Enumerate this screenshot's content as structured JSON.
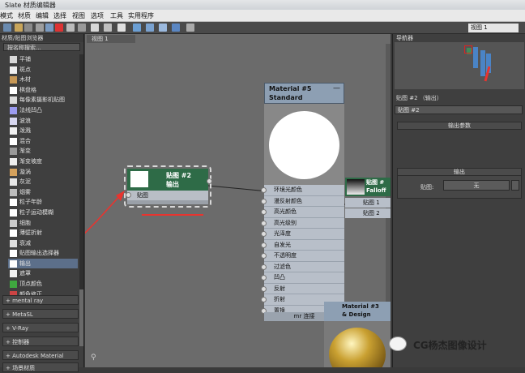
{
  "window": {
    "title": "Slate 材质编辑器"
  },
  "menu": [
    "模式",
    "材质",
    "编辑",
    "选择",
    "视图",
    "选项",
    "工具",
    "实用程序"
  ],
  "toolbar": {
    "view_select": "视图 1"
  },
  "left_panel": {
    "title": "材质/贴图浏览器",
    "search_placeholder": "按名称搜索...",
    "items": [
      {
        "label": "平铺",
        "swatch": "#d8d8d8"
      },
      {
        "label": "斑点",
        "swatch": "#f0f0f0"
      },
      {
        "label": "木材",
        "swatch": "#c79856"
      },
      {
        "label": "棋盘格",
        "swatch": "#ffffff"
      },
      {
        "label": "每像素摄影机贴图",
        "swatch": "#dcdcdc"
      },
      {
        "label": "法线凹凸",
        "swatch": "#9b9bf0"
      },
      {
        "label": "波浪",
        "swatch": "#d8d8f0"
      },
      {
        "label": "泼溅",
        "swatch": "#f0f0f0"
      },
      {
        "label": "混合",
        "swatch": "#ffffff"
      },
      {
        "label": "渐变",
        "swatch": "#999999"
      },
      {
        "label": "渐变坡度",
        "swatch": "#eeeeee"
      },
      {
        "label": "漩涡",
        "swatch": "#d4a15c"
      },
      {
        "label": "灰泥",
        "swatch": "#e6e6e6"
      },
      {
        "label": "烟雾",
        "swatch": "#bdbdbd"
      },
      {
        "label": "粒子年龄",
        "swatch": "#ffffff"
      },
      {
        "label": "粒子运动模糊",
        "swatch": "#ffffff"
      },
      {
        "label": "细胞",
        "swatch": "#cccccc"
      },
      {
        "label": "薄壁折射",
        "swatch": "#ffffff"
      },
      {
        "label": "衰减",
        "swatch": "#dddddd"
      },
      {
        "label": "贴图输出选择器",
        "swatch": "#ffffff"
      },
      {
        "label": "输出",
        "swatch": "#ffffff"
      },
      {
        "label": "遮罩",
        "swatch": "#f0f0f0"
      },
      {
        "label": "顶点颜色",
        "swatch": "#3fa83f"
      },
      {
        "label": "颜色修正",
        "swatch": "#c44"
      }
    ],
    "selected_index": 20,
    "rollouts": [
      "+ mental ray",
      "+ MetaSL",
      "+ V-Ray",
      "+ 控制器",
      "+ Autodesk Material Library",
      "+ 场景材质"
    ]
  },
  "viewport": {
    "tab": "视图 1",
    "output_node": {
      "title1": "贴图 #2",
      "title2": "输出",
      "slot": "贴图"
    },
    "material_node": {
      "title1": "Material #5",
      "title2": "Standard",
      "slots": [
        "环境光颜色",
        "漫反射颜色",
        "高光颜色",
        "高光级别",
        "光泽度",
        "自发光",
        "不透明度",
        "过滤色",
        "凹凸",
        "反射",
        "折射",
        "置换"
      ],
      "footer": "mr 连接"
    },
    "falloff_node": {
      "title1": "贴图 #",
      "title2": "Falloff",
      "slot1": "贴图 1",
      "slot2": "贴图 2"
    },
    "material3_node": {
      "title1": "Material #3",
      "title2": "& Design"
    }
  },
  "right_panel": {
    "navigator": "导航器",
    "props_title": "贴图 #2 （输出）",
    "name_field": "贴图 #2",
    "rollout_params": "输出参数",
    "map_label": "贴图:",
    "map_value": "无",
    "rollout_output": "输出"
  },
  "watermark": {
    "text": "CG杨杰图像设计"
  },
  "colors": {
    "node_green": "#2e6b47",
    "material_header": "#8d9fb3",
    "arrow": "#e8342f"
  }
}
